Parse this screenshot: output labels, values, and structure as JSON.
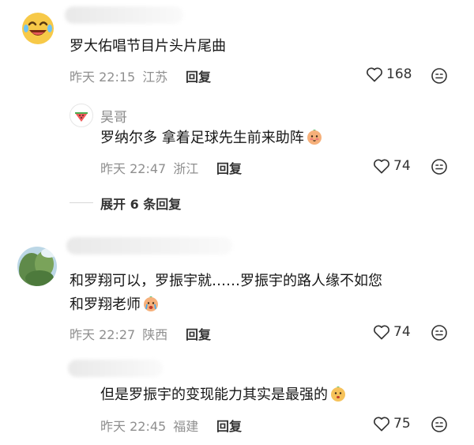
{
  "comments": [
    {
      "content": "罗大佑唱节目片头片尾曲",
      "time": "昨天 22:15",
      "location": "江苏",
      "reply_label": "回复",
      "likes": "168",
      "replies": [
        {
          "username": "昊哥",
          "content": "罗纳尔多 拿着足球先生前来助阵",
          "time": "昨天 22:47",
          "location": "浙江",
          "reply_label": "回复",
          "likes": "74"
        }
      ],
      "expand_label": "展开 6 条回复"
    },
    {
      "content_line1": "和罗翔可以，罗振宇就……罗振宇的路人缘不如您",
      "content_line2": "和罗翔老师",
      "time": "昨天 22:27",
      "location": "陕西",
      "reply_label": "回复",
      "likes": "74",
      "replies": [
        {
          "content": "但是罗振宇的变现能力其实是最强的",
          "time": "昨天 22:45",
          "location": "福建",
          "reply_label": "回复",
          "likes": "75"
        }
      ]
    }
  ],
  "colors": {
    "meta_text": "#8f8f8f",
    "content_text": "#161616",
    "action_text": "#333333"
  },
  "icons": [
    "laughing-emoji-avatar",
    "watermelon-avatar",
    "heart-icon",
    "sticker-icon",
    "face-emoji"
  ]
}
